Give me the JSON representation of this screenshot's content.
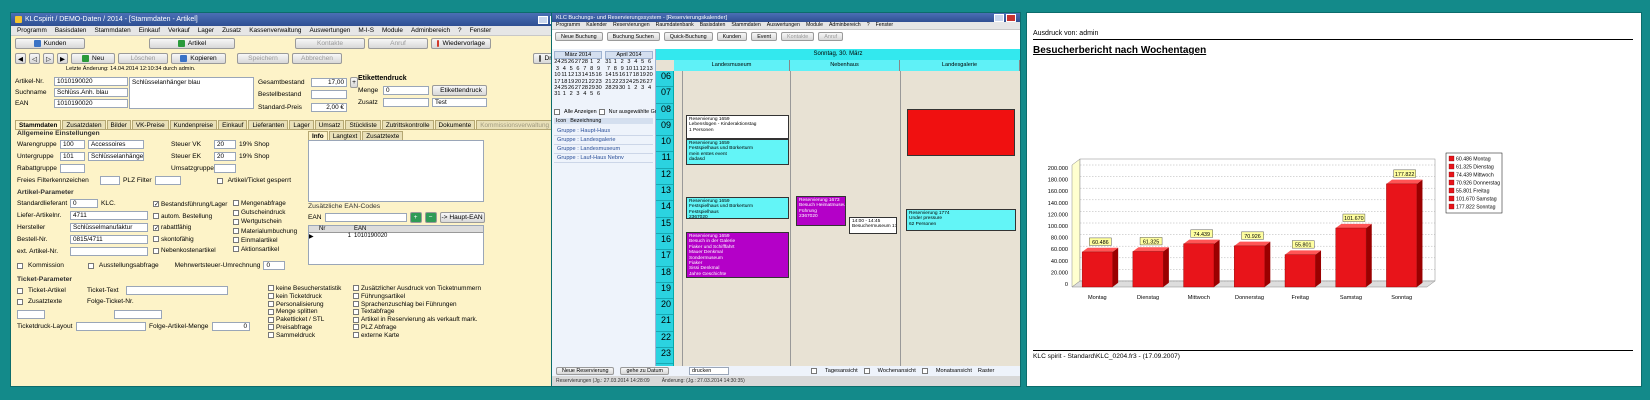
{
  "w1": {
    "title": "KLCspirit / DEMO-Daten / 2014 - [Stammdaten - Artikel]",
    "menu": [
      "Programm",
      "Basisdaten",
      "Stammdaten",
      "Einkauf",
      "Verkauf",
      "Lager",
      "Zusatz",
      "Kassenverwaltung",
      "Auswertungen",
      "M-I-S",
      "Module",
      "Adminbereich",
      "?",
      "Fenster"
    ],
    "modules": {
      "kunden": "Kunden",
      "artikel": "Artikel",
      "kontakte": "Kontakte",
      "anruf": "Anruf",
      "wiedervorlage": "Wiedervorlage"
    },
    "toolbar": {
      "neu": "Neu",
      "loeschen": "Löschen",
      "kopieren": "Kopieren",
      "speichern": "Speichern",
      "abbrechen": "Abbrechen",
      "drucken": "Drucken"
    },
    "last_change": "Letzte Änderung: 14.04.2014 12:10:34 durch admin.",
    "artikel_nr_label": "Artikel-Nr.",
    "artikel_nr": "1010190020",
    "suchname_label": "Suchname",
    "suchname": "Schlüss.Anh. blau",
    "ean_label": "EAN",
    "ean": "1010190020",
    "bezeichnung": "Schlüsselanhänger blau",
    "gesamtbestand_label": "Gesamtbestand",
    "gesamtbestand": "17,00",
    "bestellbestand_label": "Bestellbestand",
    "standardpreis_label": "Standard-Preis",
    "standardpreis": "2,00 €",
    "etikettendruck_label": "Etikettendruck",
    "menge_label": "Menge",
    "menge": "0",
    "etikettendruck_btn": "Etikettendruck",
    "zusatz_label": "Zusatz",
    "zusatz_value": "Test",
    "tabs": [
      "Stammdaten",
      "Zusatzdaten",
      "Bilder",
      "VK-Preise",
      "Kundenpreise",
      "Einkauf",
      "Lieferanten",
      "Lager",
      "Umsatz",
      "Stückliste",
      "Zutrittskontrolle",
      "Dokumente",
      "Kommissionsverwaltung",
      "Fil"
    ],
    "allg_label": "Allgemeine Einstellungen",
    "warengruppe_label": "Warengruppe",
    "warengruppe_nr": "100",
    "warengruppe_text": "Accessoires",
    "untergruppe_label": "Untergruppe",
    "untergruppe_nr": "101",
    "untergruppe_text": "Schlüsselanhänger",
    "rabattgruppe_label": "Rabattgruppe",
    "steuer_vk_label": "Steuer VK",
    "steuer_vk_nr": "20",
    "steuer_vk_text": "19% Shop",
    "steuer_ek_label": "Steuer EK",
    "steuer_ek_nr": "20",
    "steuer_ek_text": "19% Shop",
    "umsatzgruppe_label": "Umsatzgruppe",
    "filterkennzeichen_label": "Freies Filterkennzeichen",
    "plz_filter_label": "PLZ Filter",
    "gesperrt_label": "Artikel/Ticket gesperrt",
    "artikel_param_label": "Artikel-Parameter",
    "standardlieferant_label": "Standardlieferant",
    "standardlieferant_nr": "0",
    "standardlieferant_text": "KLC.",
    "liefer_artikelnr_label": "Liefer-Artikelnr.",
    "liefer_artikelnr": "4711",
    "hersteller_label": "Hersteller",
    "hersteller": "Schlüsselmanufaktur",
    "bestell_nr_label": "Bestell-Nr.",
    "bestell_nr": "0815/4711",
    "ext_artikel_label": "ext. Artikel-Nr.",
    "checks_a": [
      {
        "t": "Bestandsführung/Lager",
        "on": true
      },
      {
        "t": "autom. Bestellung",
        "on": false
      },
      {
        "t": "rabattfähig",
        "on": true
      },
      {
        "t": "skontofähig",
        "on": false
      },
      {
        "t": "Nebenkostenartikel",
        "on": false
      }
    ],
    "checks_b": [
      {
        "t": "Mengenabfrage",
        "on": false
      },
      {
        "t": "Gutscheindruck",
        "on": false
      },
      {
        "t": "Wertgutschein",
        "on": false
      },
      {
        "t": "Materialumbuchung",
        "on": false
      },
      {
        "t": "Einmalartikel",
        "on": false
      },
      {
        "t": "Aktionsartikel",
        "on": false
      }
    ],
    "kommission_label": "Kommission",
    "ausstellung_label": "Ausstellungsabfrage",
    "mwst_label": "Mehrwertsteuer-Umrechnung",
    "mwst_value": "0",
    "subtabs": [
      "Info",
      "Langtext",
      "Zusatztexte"
    ],
    "ean_codes_label": "Zusätzliche EAN-Codes",
    "ean_label2": "EAN",
    "haupt_ean": "-> Haupt-EAN",
    "ean_table": {
      "h": [
        "Nr",
        "EAN"
      ],
      "rows": [
        [
          "1",
          "1010190020"
        ]
      ]
    },
    "ticket_label": "Ticket-Parameter",
    "ticket_artikel": "Ticket-Artikel",
    "ticket_text": "Ticket-Text",
    "zusatztexte": "Zusatztexte",
    "folge_ticket": "Folge-Ticket-Nr.",
    "ticketdruck": "Ticketdruck-Layout",
    "folge_menge": "Folge-Artikel-Menge",
    "folge_menge_val": "0",
    "checks_c": [
      "keine Besucherstatistik",
      "kein Ticketdruck",
      "Personalisierung",
      "Menge splitten",
      "Paketticket / STL",
      "Preisabfrage",
      "Sammeldruck"
    ],
    "checks_d": [
      "Zusätzlicher Ausdruck von Ticketnummern",
      "Führungsartikel",
      "Sprachenzuschlag bei Führungen",
      "Textabfrage",
      "Artikel in Reservierung als verkauft mark.",
      "PLZ Abfrage",
      "externe Karte"
    ]
  },
  "w2": {
    "title": "KLC Buchungs- und Reservierungssystem - [Reservierungskalender]",
    "menu": [
      "Programm",
      "Kalender",
      "Reservierungen",
      "Raumdatenbank",
      "Basisdaten",
      "Stammdaten",
      "Auswertungen",
      "Module",
      "Adminbereich",
      "?",
      "Fenster"
    ],
    "toolbar": [
      "Neue Buchung",
      "Buchung Suchen",
      "Quick-Buchung",
      "Kunden",
      "Event",
      "Kontakte",
      "Anruf"
    ],
    "month1": "März 2014",
    "month2": "April 2014",
    "month1_days": [
      "24",
      "25",
      "26",
      "27",
      "28",
      "1",
      "2",
      "3",
      "4",
      "5",
      "6",
      "7",
      "8",
      "9",
      "10",
      "11",
      "12",
      "13",
      "14",
      "15",
      "16",
      "17",
      "18",
      "19",
      "20",
      "21",
      "22",
      "23",
      "24",
      "25",
      "26",
      "27",
      "28",
      "29",
      "30",
      "31",
      "1",
      "2",
      "3",
      "4",
      "5",
      "6"
    ],
    "month2_days": [
      "31",
      "1",
      "2",
      "3",
      "4",
      "5",
      "6",
      "7",
      "8",
      "9",
      "10",
      "11",
      "12",
      "13",
      "14",
      "15",
      "16",
      "17",
      "18",
      "19",
      "20",
      "21",
      "22",
      "23",
      "24",
      "25",
      "26",
      "27",
      "28",
      "29",
      "30",
      "1",
      "2",
      "3",
      "4"
    ],
    "filter_all": "Alle Anzeigen",
    "filter_sel": "Nur ausgewählte Gruppe",
    "list_head": [
      "Icon",
      "Bezeichnung"
    ],
    "groups": [
      "Gruppe : Haupt-Haus",
      "Gruppe : Landesgalerie",
      "Gruppe : Landesmuseum",
      "Gruppe : Lauf-Haus Nebnv"
    ],
    "date": "Sonntag, 30. März",
    "columns": [
      "Landesmuseum",
      "Nebenhaus",
      "Landesgalerie"
    ],
    "hours": [
      "06",
      "07",
      "08",
      "09",
      "10",
      "11",
      "12",
      "13",
      "14",
      "15",
      "16",
      "17",
      "18",
      "19",
      "20",
      "21",
      "22",
      "23"
    ],
    "events": [
      {
        "lines": [
          "Reservierung 1659",
          "Lebenslügen - Kinderaktionstag",
          "",
          "1 Personen"
        ],
        "color": "#ffffff"
      },
      {
        "lines": [
          "Reservierung 1659",
          "Festspielhaus und Bürkerturm",
          "mein erstes event",
          "dadasd"
        ],
        "color": "#63f5f7"
      },
      {
        "lines": [
          "Reservierung 1659",
          "Festspielhaus und Bürkerturm",
          "Festspielhaus",
          "2367020"
        ],
        "color": "#63f5f7"
      },
      {
        "lines": [
          "Reservierung 1659",
          "Besuch in der Galerie",
          "Fiaker und Schifffahrt",
          "Mauer Denkmal",
          "Sondermuseum",
          "Fiaker",
          "Sissi Denkmal",
          "Jahre Geschichte"
        ],
        "color": "#b400c8"
      },
      {
        "lines": [
          "Reservierung 1673",
          "Besuch Heimatmuseum",
          "Führung",
          "2367020"
        ],
        "color": "#b400c8"
      },
      {
        "lines": [
          "14:00 - 14:45",
          "Besuchermuseum 1701"
        ],
        "color": "#ffffff"
      },
      {
        "lines": [
          "Reservierung 1774",
          "Under pressure",
          "",
          "62 Personen"
        ],
        "color": "#63f5f7"
      },
      {
        "lines": [
          ""
        ],
        "color": "#f01010"
      }
    ],
    "bottom": [
      "Neue Reservierung",
      "gehe zu Datum"
    ],
    "status_left": "Reservierungen (Jg.: 27.03.2014 14:28:09",
    "status_mid": "Änderung: (Jg.: 27.03.2014 14:30:35)",
    "search_value": "drucken",
    "views": [
      "Tagesansicht",
      "Wochenansicht",
      "Monatsansicht"
    ],
    "raster": "Raster"
  },
  "w3": {
    "printed_by": "Ausdruck von: admin",
    "report_title": "Besucherbericht nach Wochentagen",
    "footer": "KLC spirit - Standard\\KLC_0204.fr3 - (17.09.2007)",
    "accent": "#e8141a"
  },
  "chart_data": {
    "type": "bar",
    "categories": [
      "Montag",
      "Dienstag",
      "Mittwoch",
      "Donnerstag",
      "Freitag",
      "Samstag",
      "Sonntag"
    ],
    "values": [
      60.486,
      61.325,
      74.439,
      70.926,
      55.801,
      101.67,
      177.822
    ],
    "value_labels": [
      "60.486",
      "61.325",
      "74.439",
      "70.926",
      "55.801",
      "101.670",
      "177.822"
    ],
    "legend": [
      "60.486 Montag",
      "61.325 Dienstag",
      "74.439 Mittwoch",
      "70.926 Donnerstag",
      "55.801 Freitag",
      "101.670 Samstag",
      "177.822 Sonntag"
    ],
    "y_ticks": [
      "0",
      "20.000",
      "40.000",
      "60.000",
      "80.000",
      "100.000",
      "120.000",
      "140.000",
      "160.000",
      "180.000",
      "200.000"
    ],
    "ylim": [
      0,
      200
    ],
    "legend_position": "top-right",
    "grid": true
  }
}
